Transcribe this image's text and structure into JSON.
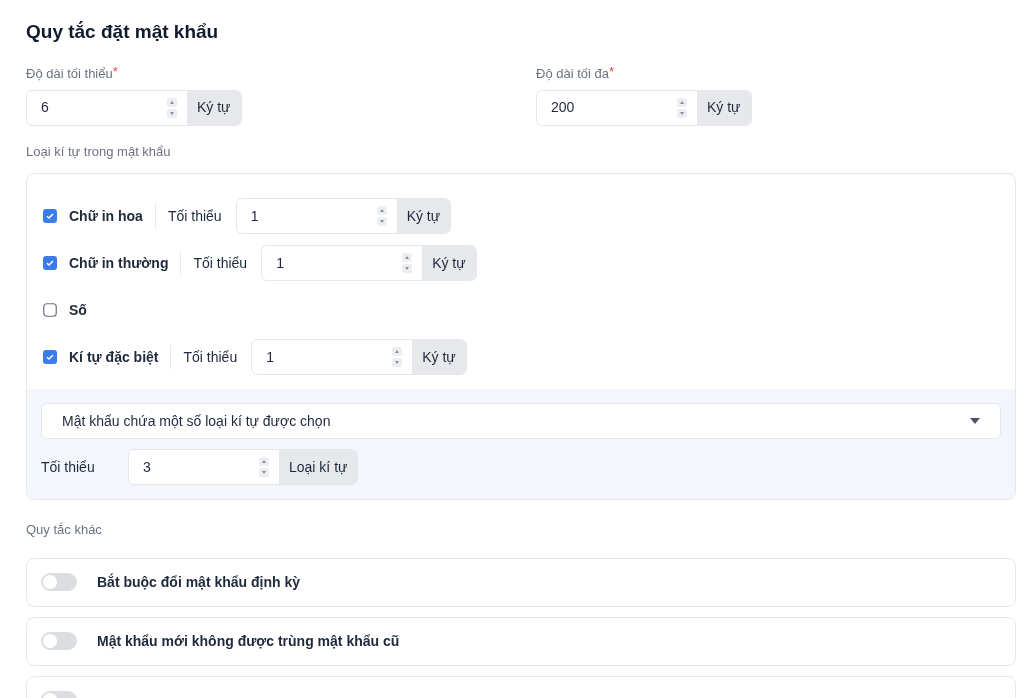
{
  "title": "Quy tắc đặt mật khẩu",
  "length_fields": [
    {
      "label": "Độ dài tối thiểu",
      "required_mark": "*",
      "value": "6",
      "unit": "Ký tự"
    },
    {
      "label": "Độ dài tối đa",
      "required_mark": "*",
      "value": "200",
      "unit": "Ký tự"
    }
  ],
  "char_types_label": "Loại kí tự trong mật khẩu",
  "char_types": [
    {
      "label": "Chữ in hoa",
      "checked": true,
      "min_label": "Tối thiểu",
      "value": "1",
      "unit": "Ký tự"
    },
    {
      "label": "Chữ in thường",
      "checked": true,
      "min_label": "Tối thiểu",
      "value": "1",
      "unit": "Ký tự"
    },
    {
      "label": "Số",
      "checked": false
    },
    {
      "label": "Kí tự đặc biệt",
      "checked": true,
      "min_label": "Tối thiểu",
      "value": "1",
      "unit": "Ký tự"
    }
  ],
  "mode_select": {
    "value": "Mật khẩu chứa một số loại kí tự được chọn"
  },
  "mode_min": {
    "label": "Tối thiểu",
    "value": "3",
    "unit": "Loại kí tự"
  },
  "other_rules_label": "Quy tắc khác",
  "other_rules": [
    {
      "label": "Bắt buộc đổi mật khẩu định kỳ",
      "on": false
    },
    {
      "label": "Mật khẩu mới không được trùng mật khẩu cũ",
      "on": false
    },
    {
      "on": false
    }
  ]
}
